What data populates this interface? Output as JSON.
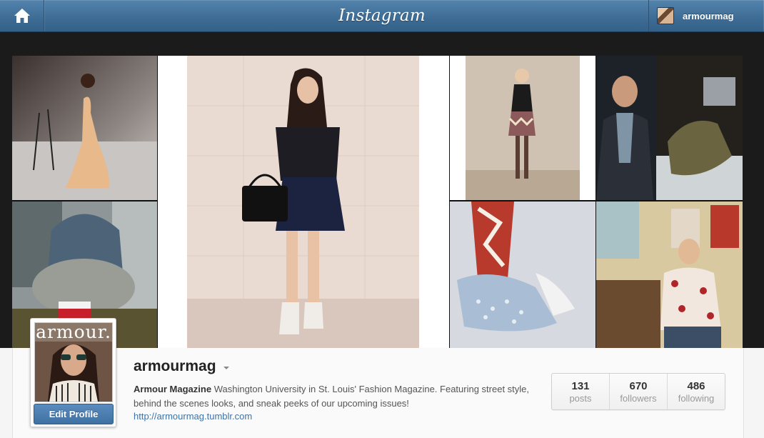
{
  "nav": {
    "logo_text": "Instagram",
    "home_icon": "home-icon",
    "username": "armourmag"
  },
  "grid": {
    "photos": [
      {
        "subject": "woman in peach gown studio"
      },
      {
        "subject": "woman in black top and navy skirt holding handbag"
      },
      {
        "subject": "woman in zigzag skirt and black top"
      },
      {
        "subject": "man in scarf and boot close-up"
      },
      {
        "subject": "knit beanie and scarf with coffee cup"
      },
      {
        "subject": "polka dot shoes with printed tights"
      },
      {
        "subject": "man in patterned jacket at desk"
      }
    ]
  },
  "profile": {
    "avatar_masthead": "armour.",
    "edit_button": "Edit Profile",
    "username": "armourmag",
    "full_name": "Armour Magazine",
    "bio": "Washington University in St. Louis' Fashion Magazine. Featuring street style, behind the scenes looks, and sneak peeks of our upcoming issues!",
    "website": "http://armourmag.tumblr.com",
    "stats": [
      {
        "count": "131",
        "label": "posts"
      },
      {
        "count": "670",
        "label": "followers"
      },
      {
        "count": "486",
        "label": "following"
      }
    ]
  },
  "colors": {
    "nav_blue": "#3d6b94",
    "button_blue": "#4f80b2",
    "link_blue": "#3f72a5"
  }
}
